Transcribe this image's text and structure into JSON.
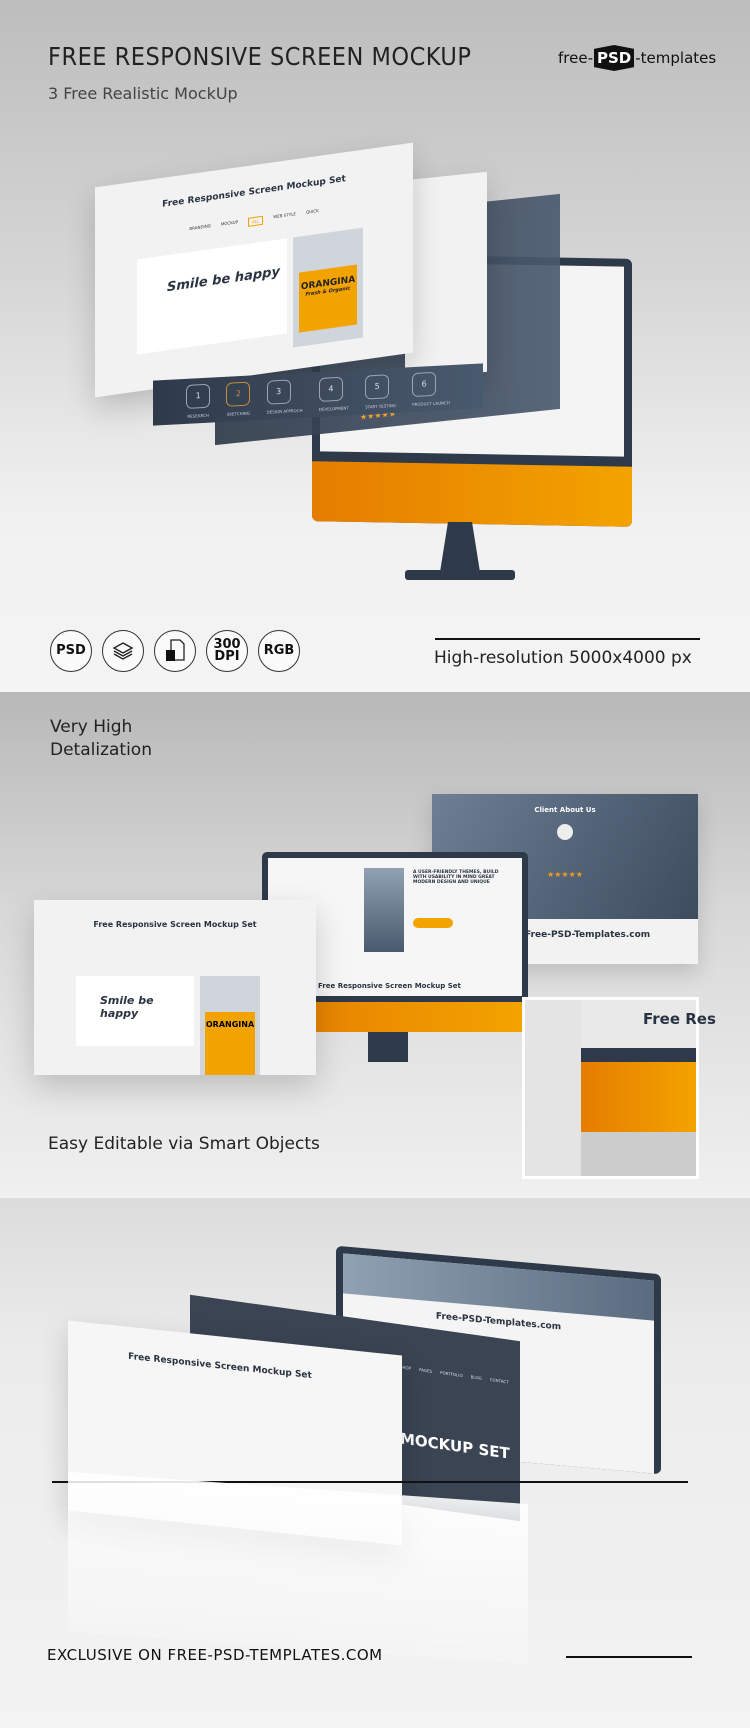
{
  "header": {
    "title": "FREE RESPONSIVE SCREEN MOCKUP",
    "subtitle": "3 Free Realistic MockUp",
    "logo": {
      "left": "free-",
      "mark": "PSD",
      "right": "-templates"
    }
  },
  "features": {
    "icons": [
      {
        "icon": "psd-icon",
        "label": "PSD"
      },
      {
        "icon": "layers-icon",
        "label": ""
      },
      {
        "icon": "smart-object-icon",
        "label": ""
      },
      {
        "icon": "dpi-icon",
        "label": "300 DPI"
      },
      {
        "icon": "rgb-icon",
        "label": "RGB"
      }
    ],
    "resolution": "High-resolution 5000x4000 px"
  },
  "mockup1": {
    "screen_title": "Free Responsive Screen Mockup Set",
    "nav": [
      "BRANDING",
      "MOCKUP",
      "ALL",
      "WEB STYLE",
      "QUICK"
    ],
    "product": "ORANGINA",
    "product_sub": "Fresh & Organic",
    "mug_text": "Smile be happy",
    "steps": [
      {
        "n": "1",
        "label": "RESEARCH"
      },
      {
        "n": "2",
        "label": "SKETCHING"
      },
      {
        "n": "3",
        "label": "DESIGN APPROCH"
      },
      {
        "n": "4",
        "label": "DEVELOPMENT"
      },
      {
        "n": "5",
        "label": "START TESTING"
      },
      {
        "n": "6",
        "label": "PRODUCT LAUNCH"
      }
    ],
    "stars": "★★★★★"
  },
  "section2": {
    "heading": "Very High Detalization",
    "footer": "Easy Editable via Smart Objects",
    "client_title": "Client About Us",
    "site_name": "Free-PSD-Templates.com",
    "theme_headline": "A USER-FRIENDLY THEMES, BUILD WITH USABILITY IN MIND GREAT MODERN DESIGN AND UNIQUE",
    "screen_title": "Free Responsive Screen Mockup Set",
    "closeup_text": "Free Res"
  },
  "section3": {
    "screen_title": "Free Responsive Screen Mockup Set",
    "banner": "MOCKUP SET",
    "site_name": "Free-PSD-Templates.com",
    "menu": [
      "SHOP",
      "PAGES",
      "PORTFOLIO",
      "BLOG",
      "CONTACT"
    ]
  },
  "footer": {
    "text": "EXCLUSIVE ON FREE-PSD-TEMPLATES.COM"
  },
  "colors": {
    "accent": "#f39c1f",
    "navy": "#2e3a4a"
  }
}
